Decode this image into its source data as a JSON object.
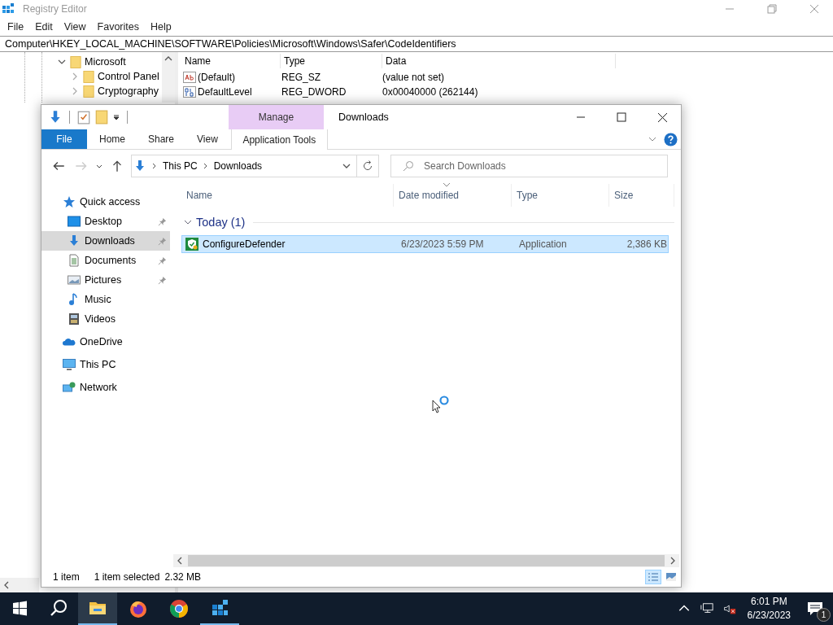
{
  "registry_editor": {
    "title": "Registry Editor",
    "menu": [
      "File",
      "Edit",
      "View",
      "Favorites",
      "Help"
    ],
    "address": "Computer\\HKEY_LOCAL_MACHINE\\SOFTWARE\\Policies\\Microsoft\\Windows\\Safer\\CodeIdentifiers",
    "tree": [
      {
        "label": "Microsoft",
        "expanded": true,
        "children": [
          {
            "label": "Control Panel",
            "expanded": false
          },
          {
            "label": "Cryptography",
            "expanded": false
          }
        ]
      }
    ],
    "columns": [
      "Name",
      "Type",
      "Data"
    ],
    "rows": [
      {
        "kind": "string",
        "name": "(Default)",
        "type": "REG_SZ",
        "data": "(value not set)"
      },
      {
        "kind": "binary",
        "name": "DefaultLevel",
        "type": "REG_DWORD",
        "data": "0x00040000 (262144)"
      }
    ]
  },
  "explorer": {
    "title": "Downloads",
    "context_group": "Manage",
    "ribbon_tabs": [
      {
        "label": "File",
        "kind": "file",
        "selected": false
      },
      {
        "label": "Home",
        "kind": "normal",
        "selected": false
      },
      {
        "label": "Share",
        "kind": "normal",
        "selected": false
      },
      {
        "label": "View",
        "kind": "normal",
        "selected": false
      },
      {
        "label": "Application Tools",
        "kind": "contextual",
        "selected": true
      }
    ],
    "breadcrumb": [
      "This PC",
      "Downloads"
    ],
    "search": {
      "placeholder": "Search Downloads"
    },
    "nav": [
      {
        "label": "Quick access",
        "kind": "star",
        "selected": false,
        "children": [
          {
            "label": "Desktop",
            "kind": "desktop",
            "selected": false,
            "pinned": true
          },
          {
            "label": "Downloads",
            "kind": "download",
            "selected": true,
            "pinned": true
          },
          {
            "label": "Documents",
            "kind": "document",
            "selected": false,
            "pinned": true
          },
          {
            "label": "Pictures",
            "kind": "pictures",
            "selected": false,
            "pinned": true
          },
          {
            "label": "Music",
            "kind": "music",
            "selected": false,
            "pinned": false
          },
          {
            "label": "Videos",
            "kind": "videos",
            "selected": false,
            "pinned": false
          }
        ]
      },
      {
        "label": "OneDrive",
        "kind": "cloud",
        "selected": false
      },
      {
        "label": "This PC",
        "kind": "pc",
        "selected": false
      },
      {
        "label": "Network",
        "kind": "network",
        "selected": false
      }
    ],
    "columns": [
      {
        "label": "Name",
        "sorted": false
      },
      {
        "label": "Date modified",
        "sorted": true
      },
      {
        "label": "Type",
        "sorted": false
      },
      {
        "label": "Size",
        "sorted": false
      }
    ],
    "groups": [
      {
        "label": "Today (1)",
        "expanded": true,
        "files": [
          {
            "name": "ConfigureDefender",
            "date": "6/23/2023 5:59 PM",
            "type": "Application",
            "size": "2,386 KB",
            "selected": true
          }
        ]
      }
    ],
    "status": {
      "count": "1 item",
      "selection": "1 item selected",
      "size": "2.32 MB"
    },
    "view_modes": [
      {
        "kind": "details",
        "selected": true
      },
      {
        "kind": "large-icons",
        "selected": false
      }
    ]
  },
  "taskbar": {
    "apps": [
      {
        "kind": "explorer",
        "active": true,
        "running": true
      },
      {
        "kind": "firefox",
        "active": false,
        "running": false
      },
      {
        "kind": "chrome",
        "active": false,
        "running": false
      },
      {
        "kind": "regedit",
        "active": false,
        "running": true
      }
    ],
    "muted": true,
    "time": "6:01 PM",
    "date": "6/23/2023",
    "notifications": "1"
  }
}
